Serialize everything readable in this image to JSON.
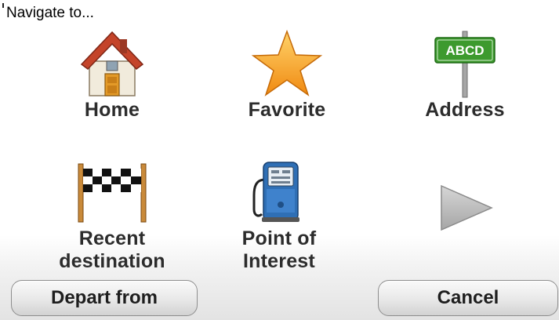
{
  "header": {
    "title": "Navigate to..."
  },
  "menu": {
    "items": [
      {
        "label": "Home",
        "icon": "house-icon"
      },
      {
        "label": "Favorite",
        "icon": "star-icon"
      },
      {
        "label": "Address",
        "icon": "street-sign-icon",
        "sign_text": "ABCD"
      },
      {
        "label": "Recent\ndestination",
        "icon": "checkered-flag-icon"
      },
      {
        "label": "Point of\nInterest",
        "icon": "fuel-pump-icon"
      }
    ],
    "next_icon": "next-page-arrow-icon"
  },
  "footer": {
    "left_button": "Depart from",
    "right_button": "Cancel"
  },
  "colors": {
    "roof": "#c4442a",
    "star": "#f5a623",
    "sign": "#3d9a2e",
    "pump": "#2f6fb5",
    "arrow": "#b8b8b8"
  }
}
